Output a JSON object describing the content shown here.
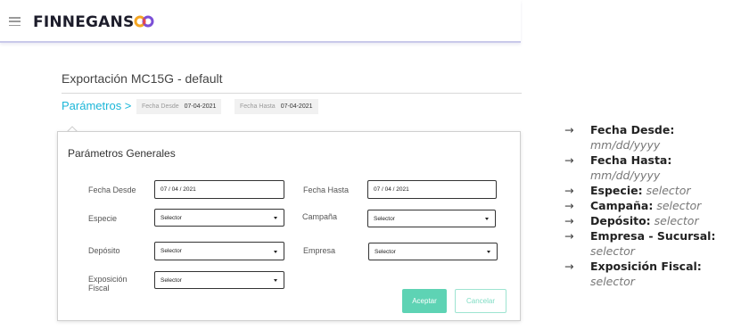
{
  "header": {
    "brand": "FINNEGANS",
    "logo_colors": [
      "#f5a623",
      "#e8474c",
      "#7b4fd6"
    ]
  },
  "page": {
    "title": "Exportación MC15G - default"
  },
  "param_strip": {
    "link": "Parámetros >",
    "chips": [
      {
        "key": "Fecha Desde",
        "value": "07-04-2021"
      },
      {
        "key": "Fecha Hasta",
        "value": "07-04-2021"
      }
    ]
  },
  "dialog": {
    "title": "Parámetros Generales",
    "fields": {
      "fecha_desde": {
        "label": "Fecha Desde",
        "value": "07 / 04 / 2021"
      },
      "fecha_hasta": {
        "label": "Fecha Hasta",
        "value": "07 / 04 / 2021"
      },
      "especie": {
        "label": "Especie",
        "value": "Selector"
      },
      "campana": {
        "label": "Campaña",
        "value": "Selector"
      },
      "deposito": {
        "label": "Depósito",
        "value": "Selector"
      },
      "empresa": {
        "label": "Empresa",
        "value": "Selector"
      },
      "exposicion_fiscal": {
        "label_line1": "Exposición",
        "label_line2": "Fiscal",
        "value": "Selector"
      }
    },
    "buttons": {
      "ok": "Aceptar",
      "cancel": "Cancelar"
    }
  },
  "notes": {
    "arrow": "→",
    "items": [
      {
        "key": "Fecha Desde:",
        "value": "mm/dd/yyyy"
      },
      {
        "key": "Fecha Hasta:",
        "value": "mm/dd/yyyy"
      },
      {
        "key": "Especie:",
        "value": "selector"
      },
      {
        "key": "Campaña:",
        "value": "selector"
      },
      {
        "key": "Depósito:",
        "value": "selector"
      },
      {
        "key": "Empresa - Sucursal:",
        "value": "selector"
      },
      {
        "key": "Exposición Fiscal:",
        "value": "selector"
      }
    ]
  },
  "colors": {
    "accent_link": "#1bb6d8",
    "accept_button": "#5ed3b4",
    "cancel_button_text": "#7fdcc4"
  }
}
